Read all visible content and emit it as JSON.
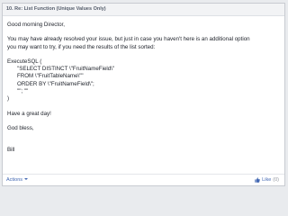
{
  "post": {
    "title": "10. Re: List Function (Unique Values Only)",
    "greeting": "Good morning Director,",
    "paragraph_line1": "You may have already resolved your issue, but just in case you haven't here is an additional option",
    "paragraph_line2": "you may want to try, if you need the results of the list sorted:",
    "code": {
      "line1": "ExecuteSQL (",
      "line2": "\"SELECT DISTINCT \\\"FruitNameField\\\"",
      "line3": "FROM \\\"FruitTableName\\\"\"",
      "line4": "ORDER BY \\\"FruitNameField\\\";",
      "line5": "\"\"; \"\"",
      "line6": ")"
    },
    "closing1": "Have a great day!",
    "closing2": "God bless,",
    "signature": "Bill"
  },
  "footer": {
    "options_label": "Actions",
    "like_label": "Like",
    "like_count": "(0)"
  },
  "icons": {
    "options": "chevron-down-icon",
    "like": "thumbs-up-icon"
  },
  "colors": {
    "link": "#4267b2",
    "text": "#1d2129",
    "header_bg": "#f2f3f5"
  }
}
